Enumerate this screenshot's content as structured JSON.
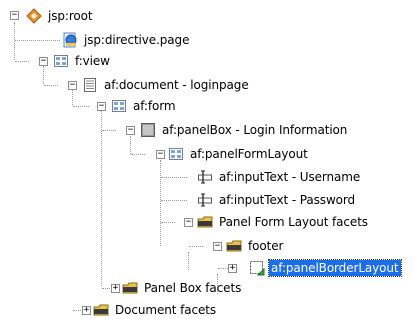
{
  "tree": {
    "nodes": [
      {
        "label": "jsp:root",
        "expander": "−",
        "icon": "jsp-root-icon"
      },
      {
        "label": "jsp:directive.page",
        "expander": "",
        "icon": "directive-page-icon"
      },
      {
        "label": "f:view",
        "expander": "−",
        "icon": "grid-component-icon"
      },
      {
        "label": "af:document - loginpage",
        "expander": "−",
        "icon": "document-icon"
      },
      {
        "label": "af:form",
        "expander": "−",
        "icon": "grid-component-icon"
      },
      {
        "label": "af:panelBox - Login Information",
        "expander": "−",
        "icon": "panel-box-icon"
      },
      {
        "label": "af:panelFormLayout",
        "expander": "−",
        "icon": "grid-component-icon"
      },
      {
        "label": "af:inputText - Username",
        "expander": "",
        "icon": "input-text-icon"
      },
      {
        "label": "af:inputText - Password",
        "expander": "",
        "icon": "input-text-icon"
      },
      {
        "label": "Panel Form Layout facets",
        "expander": "−",
        "icon": "facet-folder-icon"
      },
      {
        "label": "footer",
        "expander": "−",
        "icon": "facet-folder-icon"
      },
      {
        "label": "af:panelBorderLayout",
        "expander": "+",
        "icon": "panel-border-layout-icon"
      },
      {
        "label": "Panel Box facets",
        "expander": "+",
        "icon": "facet-folder-icon"
      },
      {
        "label": "Document facets",
        "expander": "+",
        "icon": "facet-folder-icon"
      }
    ]
  },
  "colors": {
    "selection": "#1c6ee8",
    "guide": "#9a9a9a"
  }
}
